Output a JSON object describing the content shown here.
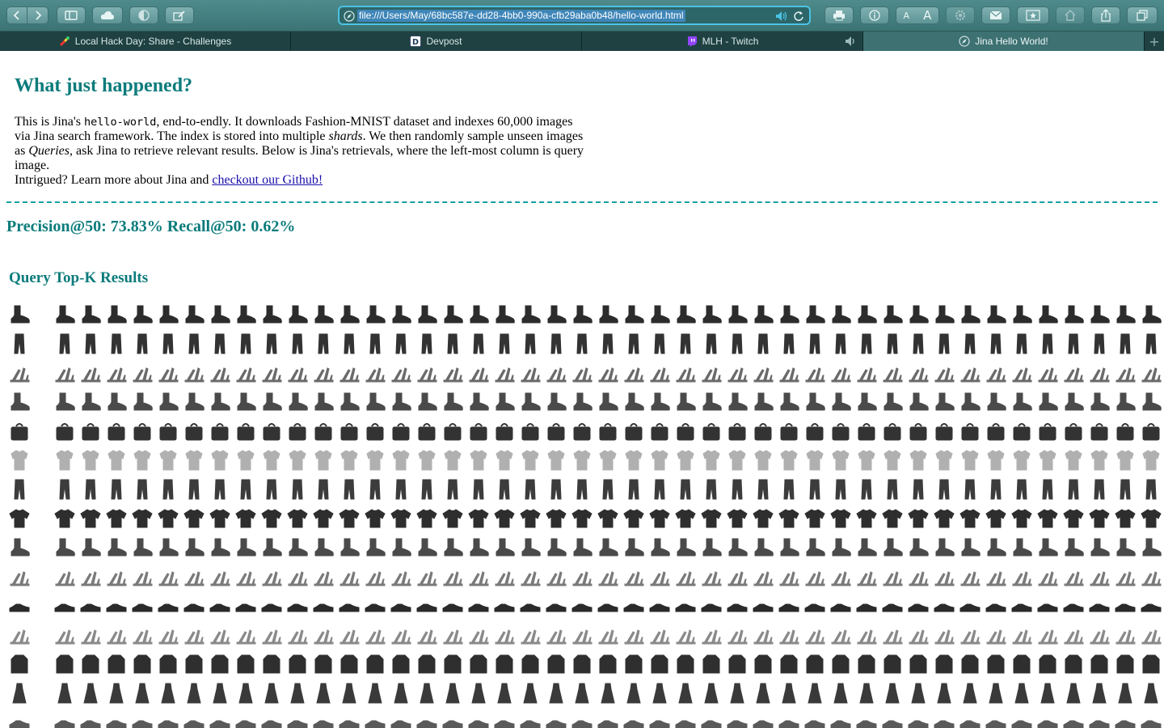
{
  "browser": {
    "url": "file:///Users/May/68bc587e-dd28-4bb0-990a-cfb29aba0b48/hello-world.html",
    "font_small": "A",
    "font_large": "A",
    "tabs": [
      {
        "label": "Local Hack Day: Share - Challenges",
        "icon": "colorful-logo-icon",
        "active": false
      },
      {
        "label": "Devpost",
        "icon": "devpost-icon",
        "active": false
      },
      {
        "label": "MLH - Twitch",
        "icon": "twitch-icon",
        "active": false
      },
      {
        "label": "Jina Hello World!",
        "icon": "compass-icon",
        "active": true
      }
    ],
    "colors": {
      "toolbar": "#3b7475",
      "accent": "#4cc2e4",
      "tabbar": "#1f4142"
    }
  },
  "page": {
    "heading": "What just happened?",
    "intro": {
      "t1": "This is Jina's ",
      "code": "hello-world",
      "t2": ", end-to-endly. It downloads Fashion-MNIST dataset and indexes 60,000 images via Jina search framework. The index is stored into multiple ",
      "shards": "shards",
      "t3": ". We then randomly sample unseen images as ",
      "queries": "Queries",
      "t4": ", ask Jina to retrieve relevant results. Below is Jina's retrievals, where the left-most column is query image.",
      "t5": "Intrigued? Learn more about Jina and ",
      "link": "checkout our Github!"
    },
    "metrics": "Precision@50: 73.83% Recall@50: 0.62%",
    "results_heading": "Query Top-K Results",
    "query_rows": [
      {
        "category": "ankle-boot",
        "shade": "#2c2c2c"
      },
      {
        "category": "trouser",
        "shade": "#333333"
      },
      {
        "category": "sandal",
        "shade": "#6a6a6a"
      },
      {
        "category": "ankle-boot",
        "shade": "#4a4a4a"
      },
      {
        "category": "bag",
        "shade": "#333333"
      },
      {
        "category": "shirt",
        "shade": "#b0b0b0"
      },
      {
        "category": "trouser",
        "shade": "#3c3c3c"
      },
      {
        "category": "t-shirt",
        "shade": "#2e2e2e"
      },
      {
        "category": "ankle-boot",
        "shade": "#4a4a4a"
      },
      {
        "category": "sandal",
        "shade": "#7a7a7a"
      },
      {
        "category": "sneaker",
        "shade": "#2a2a2a"
      },
      {
        "category": "sandal",
        "shade": "#8a8a8a"
      },
      {
        "category": "pullover",
        "shade": "#2f2f2f"
      },
      {
        "category": "dress",
        "shade": "#3a3a3a"
      },
      {
        "category": "sneaker",
        "shade": "#5a5a5a"
      }
    ],
    "results_per_row": 43
  }
}
